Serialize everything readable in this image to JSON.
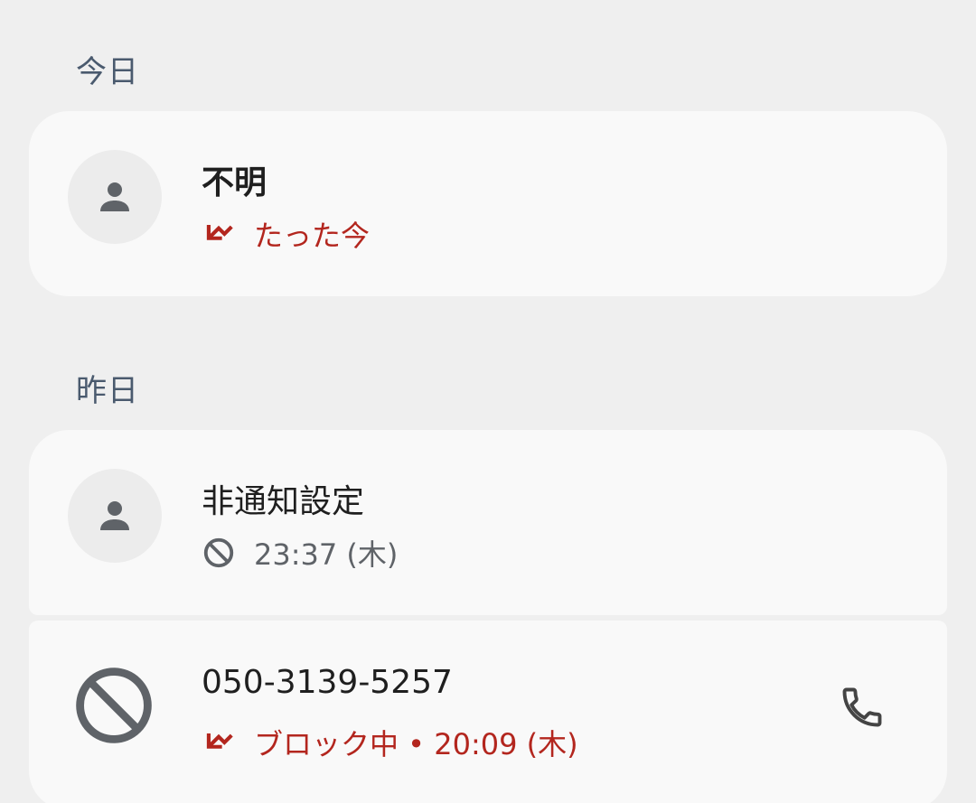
{
  "sections": [
    {
      "header": "今日",
      "calls": [
        {
          "name": "不明",
          "status": "たった今",
          "type": "missed",
          "icon": "missed-call-icon"
        }
      ]
    },
    {
      "header": "昨日",
      "calls": [
        {
          "name": "非通知設定",
          "status": "23:37 (木)",
          "type": "blocked",
          "icon": "block-icon"
        },
        {
          "name": "050-3139-5257",
          "status": "ブロック中 • 20:09 (木)",
          "type": "missed",
          "icon": "missed-call-icon",
          "action_icon": "phone-icon"
        }
      ]
    }
  ],
  "colors": {
    "background": "#efefef",
    "card": "#f9f9f9",
    "missed": "#b3261e",
    "secondary": "#5f6368",
    "header": "#4a5a6e"
  }
}
